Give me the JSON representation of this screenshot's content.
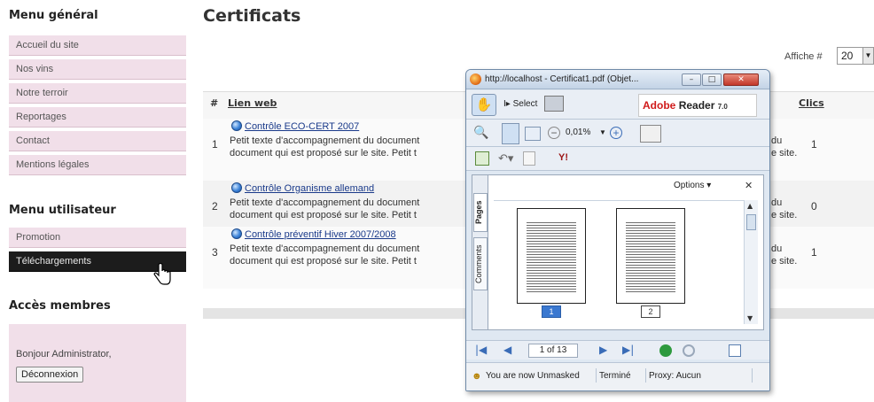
{
  "sidebar": {
    "menu_general_title": "Menu général",
    "menu_general_items": [
      "Accueil du site",
      "Nos vins",
      "Notre terroir",
      "Reportages",
      "Contact",
      "Mentions légales"
    ],
    "menu_user_title": "Menu utilisateur",
    "menu_user_items": [
      "Promotion",
      "Téléchargements"
    ],
    "members_title": "Accès membres",
    "greeting": "Bonjour Administrator,",
    "logout_label": "Déconnexion"
  },
  "main": {
    "title": "Certificats",
    "per_page_label": "Affiche #",
    "per_page_value": "20",
    "table": {
      "headers": {
        "num": "#",
        "web": "Lien web",
        "clics": "Clics"
      },
      "rows": [
        {
          "num": "1",
          "link": "Contrôle ECO-CERT 2007",
          "desc1": "Petit texte d'accompagnement du document",
          "desc2": "document qui est proposé sur le site. Petit t",
          "tail1": "du",
          "tail2": "e site.",
          "clics": "1"
        },
        {
          "num": "2",
          "link": "Contrôle Organisme allemand",
          "desc1": "Petit texte d'accompagnement du document",
          "desc2": "document qui est proposé sur le site. Petit t",
          "tail1": "du",
          "tail2": "e site.",
          "clics": "0"
        },
        {
          "num": "3",
          "link": "Contrôle préventif Hiver 2007/2008",
          "desc1": "Petit texte d'accompagnement du document",
          "desc2": "document qui est proposé sur le site. Petit t",
          "tail1": "du",
          "tail2": "e site.",
          "clics": "1"
        }
      ]
    }
  },
  "popup": {
    "title": "http://localhost - Certificat1.pdf (Objet...",
    "select_label": "Select",
    "adobe_brand": "Adobe",
    "adobe_product": "Reader",
    "adobe_version": "7.0",
    "zoom_value": "0,01%",
    "yahoo_label": "Y!",
    "options_label": "Options",
    "tab_pages": "Pages",
    "tab_comments": "Comments",
    "thumb_1": "1",
    "thumb_2": "2",
    "page_indicator": "1 of 13",
    "status": [
      "You are now Unmasked",
      "Terminé",
      "Proxy: Aucun"
    ]
  },
  "colors": {
    "menu_bg": "#f1dfe9",
    "menu_active_bg": "#1c1c1c",
    "link_blue": "#1a3a8a",
    "adobe_red": "#d01a1a"
  }
}
